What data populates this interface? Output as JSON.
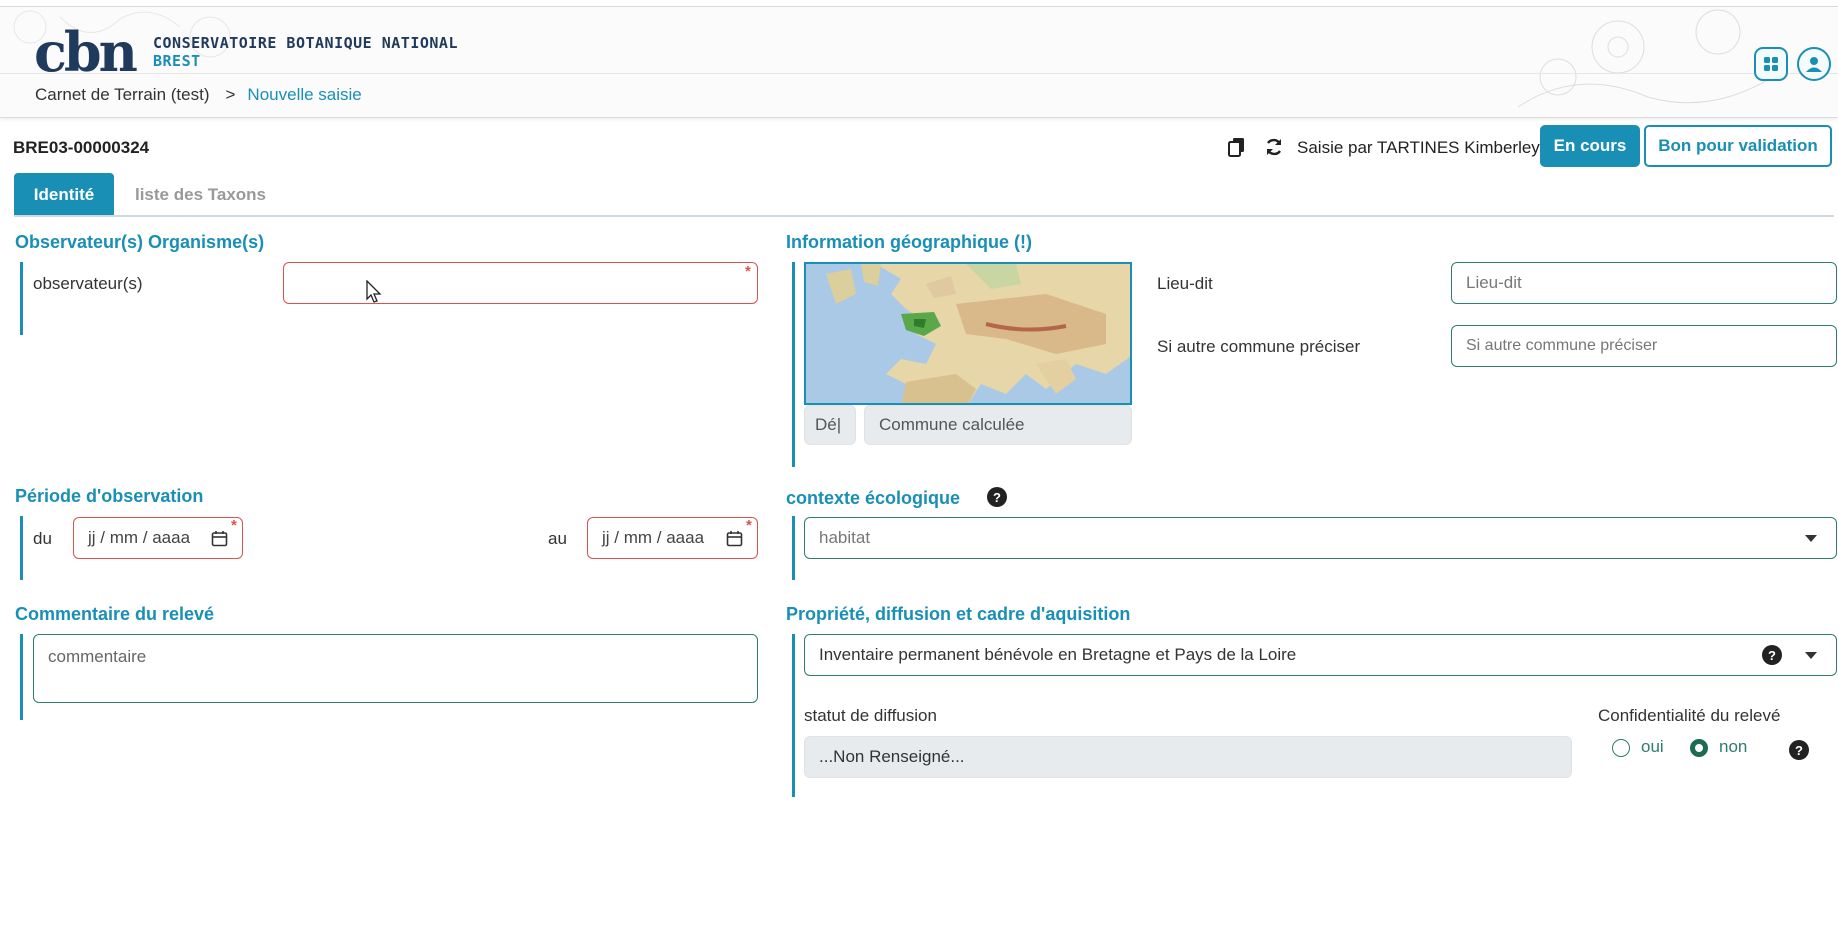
{
  "header": {
    "logo_text": "cbn",
    "org_line1": "CONSERVATOIRE BOTANIQUE NATIONAL",
    "org_line2": "BREST",
    "breadcrumb": [
      "Carnet de Terrain (test)",
      ">",
      "Nouvelle saisie"
    ],
    "icons": [
      "apps-grid-icon",
      "user-icon"
    ]
  },
  "record": {
    "id": "BRE03-00000324",
    "saisie_par": "Saisie par TARTINES Kimberley",
    "status_button": "En cours",
    "validation_button": "Bon pour validation",
    "icons": [
      "copy-icon",
      "refresh-icon"
    ]
  },
  "tabs": [
    {
      "label": "Identité",
      "active": true
    },
    {
      "label": "liste des Taxons",
      "active": false
    }
  ],
  "observateurs": {
    "title": "Observateur(s) Organisme(s)",
    "label": "observateur(s)",
    "value": ""
  },
  "geo": {
    "title": "Information géographique (!)",
    "dep_placeholder": "Dé|",
    "commune_placeholder": "Commune calculée",
    "lieu_dit_label": "Lieu-dit",
    "lieu_dit_placeholder": "Lieu-dit",
    "autre_commune_label": "Si autre commune préciser",
    "autre_commune_placeholder": "Si autre commune préciser"
  },
  "periode": {
    "title": "Période d'observation",
    "du_label": "du",
    "au_label": "au",
    "date_placeholder": "jj / mm / aaaa"
  },
  "ecologie": {
    "title": "contexte écologique",
    "habitat_placeholder": "habitat"
  },
  "commentaire": {
    "title": "Commentaire du relevé",
    "placeholder": "commentaire"
  },
  "propriete": {
    "title": "Propriété, diffusion et cadre d'aquisition",
    "selected": "Inventaire permanent bénévole en Bretagne et Pays de la Loire",
    "statut_label": "statut de diffusion",
    "statut_value": "...Non Renseigné...",
    "confidentialite_label": "Confidentialité du relevé",
    "oui_label": "oui",
    "non_label": "non",
    "selected_option": "non"
  },
  "colors": {
    "accent": "#1a8fb5",
    "border_green": "#2e7d6e",
    "required": "#d9534f"
  }
}
